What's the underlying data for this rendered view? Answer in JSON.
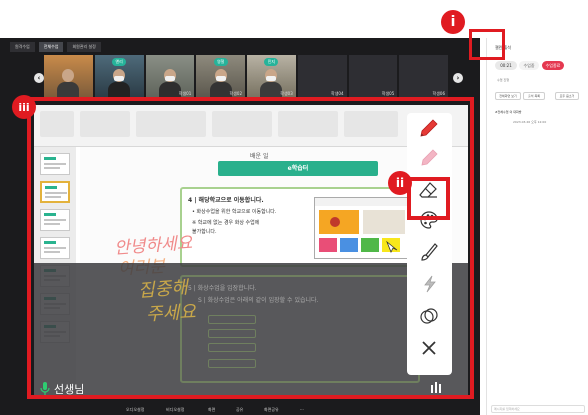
{
  "tabs": [
    "원격수업",
    "전체수업",
    "회원관리 설정"
  ],
  "video_tiles": [
    {
      "badge": "",
      "name": ""
    },
    {
      "badge": "앤리",
      "name": ""
    },
    {
      "badge": "",
      "name": "학생01"
    },
    {
      "badge": "영철",
      "name": "학생02"
    },
    {
      "badge": "민지",
      "name": "학생03"
    },
    {
      "badge": "",
      "name": "학생04"
    },
    {
      "badge": "",
      "name": "학생05"
    },
    {
      "badge": "",
      "name": "학생06"
    }
  ],
  "prev_arrow": "‹",
  "next_arrow": "›",
  "slide": {
    "tag": "배운 일",
    "green_banner": "e학습터",
    "card_title": "4 | 해당학교으로 이동합니다.",
    "card_lines": [
      "• 화상수업을 위한 학교으로 이동합니다.",
      "※ 학교에 없는 경우 화상 수업에",
      "   불가합니다."
    ],
    "hand_text_1": "안녕하세요",
    "hand_text_2": "여러분",
    "hand_text_3": "집중해",
    "hand_text_4": "주세요",
    "dim_card_title": "5 | 화상수업을 입장합니다.",
    "dim_card_line": "S | 화상수업은 아래의 같이 입장할 수 있습니다."
  },
  "toolbar": {
    "tools": [
      "pen-icon",
      "highlighter-icon",
      "eraser-icon",
      "palette-icon",
      "brush-icon",
      "laser-icon",
      "shapes-icon",
      "close-icon"
    ]
  },
  "presenter": {
    "name": "선생님"
  },
  "bottom_bar": {
    "items": [
      "오디오설정",
      "비디오설정",
      "화면",
      "공유",
      "화면공유",
      "···"
    ]
  },
  "right_panel": {
    "title": "챌린 출석",
    "pill_left": "00:21",
    "pill_mid": "수업중",
    "pill_right": "수업종료",
    "small_1": "수업 진행",
    "small_2": "#전체수업 의 대화방",
    "small_3": "2023.03.26 오후 12:00",
    "btn_1": "전체화면 보기",
    "btn_2": "출석 목록",
    "btn_3": "모두 음소거",
    "input_placeholder": "메시지를 입력하세요"
  },
  "annotations": {
    "marker_1": "i",
    "marker_2": "ii",
    "marker_3": "iii"
  },
  "colors": {
    "annotation_red": "#e01b21",
    "teal": "#29b08c",
    "dark_bg": "#1b1b1d"
  }
}
